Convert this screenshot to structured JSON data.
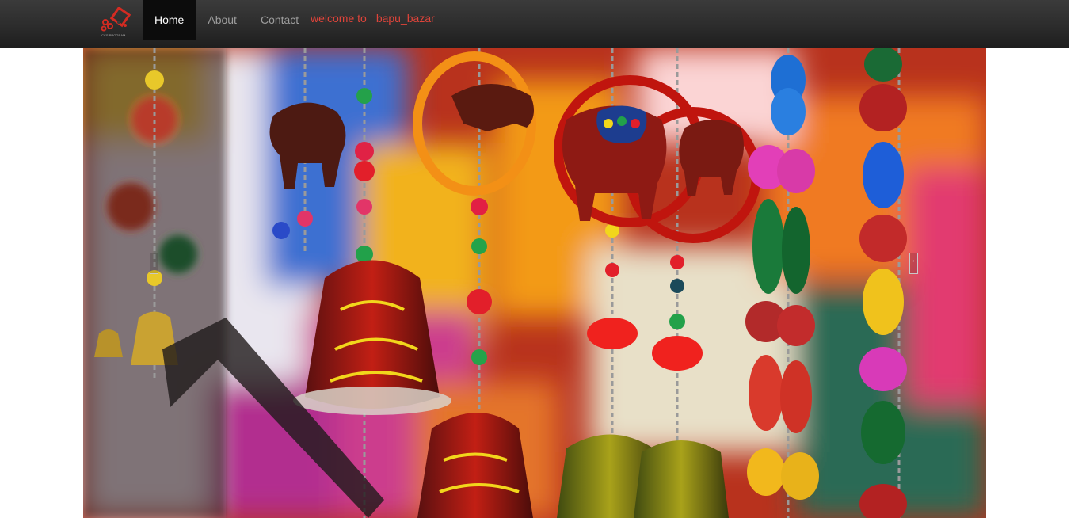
{
  "navbar": {
    "brand_icon": "bapu-bazar-logo",
    "brand_text": "ICCS PROGRAM",
    "items": [
      {
        "label": "Home",
        "active": true
      },
      {
        "label": "About",
        "active": false
      },
      {
        "label": "Contact",
        "active": false
      }
    ],
    "welcome_prefix": "welcome to",
    "welcome_site": "bapu_bazar"
  },
  "carousel": {
    "slide_image": "colorful-hanging-handicraft-bells-elephants",
    "prev_control": "prev-arrow-icon",
    "next_control": "next-arrow-icon"
  },
  "colors": {
    "navbar_bg": "#2c2c2c",
    "nav_active_bg": "#0c0c0c",
    "nav_text": "#9d9d9d",
    "welcome_text": "#e0443a"
  }
}
